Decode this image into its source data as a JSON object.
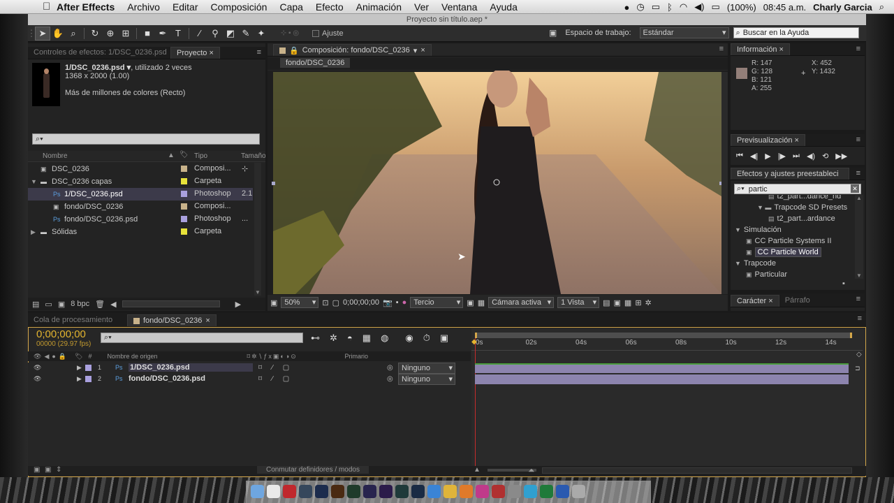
{
  "menubar": {
    "apple": "",
    "app": "After Effects",
    "items": [
      "Archivo",
      "Editar",
      "Composición",
      "Capa",
      "Efecto",
      "Animación",
      "Ver",
      "Ventana",
      "Ayuda"
    ],
    "battery": "(100%)",
    "time": "08:45 a.m.",
    "user": "Charly Garcia"
  },
  "window": {
    "title": "Proyecto sin título.aep *"
  },
  "toolbar": {
    "snap_label": "Ajuste",
    "workspace_label": "Espacio de trabajo:",
    "workspace_value": "Estándar",
    "help_placeholder": "Buscar en la Ayuda"
  },
  "project": {
    "tab_effects": "Controles de efectos: 1/DSC_0236.psd",
    "tab_project": "Proyecto",
    "item_name": "1/DSC_0236.psd ▾",
    "item_used": ", utilizado 2 veces",
    "item_dims": "1368 x 2000 (1.00)",
    "item_colors": "Más de millones de colores (Recto)",
    "search_icon": "⌕▾",
    "col_name": "Nombre",
    "col_type": "Tipo",
    "col_size": "Tamaño",
    "items": [
      {
        "name": "DSC_0236",
        "type": "Composi...",
        "extra": "",
        "indent": 0,
        "color": "#c8b28a",
        "kind": "comp"
      },
      {
        "name": "DSC_0236 capas",
        "type": "Carpeta",
        "extra": "",
        "indent": 0,
        "color": "#e8e23a",
        "kind": "folder"
      },
      {
        "name": "1/DSC_0236.psd",
        "type": "Photoshop",
        "extra": "2.1",
        "indent": 1,
        "color": "#a9a0de",
        "kind": "psd"
      },
      {
        "name": "fondo/DSC_0236",
        "type": "Composi...",
        "extra": "",
        "indent": 1,
        "color": "#c8b28a",
        "kind": "comp"
      },
      {
        "name": "fondo/DSC_0236.psd",
        "type": "Photoshop",
        "extra": "...",
        "indent": 1,
        "color": "#a9a0de",
        "kind": "psd"
      },
      {
        "name": "Sólidas",
        "type": "Carpeta",
        "extra": "",
        "indent": 0,
        "color": "#e8e23a",
        "kind": "folder"
      }
    ],
    "bpc": "8 bpc"
  },
  "comp": {
    "tab": "Composición: fondo/DSC_0236",
    "flow": "fondo/DSC_0236",
    "zoom": "50%",
    "timecode": "0;00;00;00",
    "grid": "Tercio",
    "camera": "Cámara activa",
    "views": "1 Vista"
  },
  "info": {
    "tab": "Información",
    "r": "R:  147",
    "g": "G:  128",
    "b": "B:  121",
    "a": "A:  255",
    "x": "X:  452",
    "y": "Y:  1432",
    "swatch": "#937f79"
  },
  "preview": {
    "tab": "Previsualización"
  },
  "effects": {
    "tab": "Efectos y ajustes preestableci",
    "search": "partic",
    "items": [
      {
        "label": "t2_part...dance_nd",
        "indent": 3,
        "kind": "preset"
      },
      {
        "label": "Trapcode SD Presets",
        "indent": 2,
        "kind": "folder"
      },
      {
        "label": "t2_part...ardance",
        "indent": 3,
        "kind": "preset"
      },
      {
        "label": "Simulación",
        "indent": 0,
        "kind": "category"
      },
      {
        "label": "CC Particle Systems II",
        "indent": 1,
        "kind": "effect"
      },
      {
        "label": "CC Particle World",
        "indent": 1,
        "kind": "effect",
        "selected": true
      },
      {
        "label": "Trapcode",
        "indent": 0,
        "kind": "category"
      },
      {
        "label": "Particular",
        "indent": 1,
        "kind": "effect"
      }
    ]
  },
  "character": {
    "tab_char": "Carácter",
    "tab_para": "Párrafo"
  },
  "timeline": {
    "tab_render": "Cola de procesamiento",
    "tab_comp": "fondo/DSC_0236",
    "timecode": "0;00;00;00",
    "fps": "00000 (29.97 fps)",
    "col_num": "#",
    "col_source": "Nombre de origen",
    "col_parent": "Primario",
    "ruler": [
      "0s",
      "02s",
      "04s",
      "06s",
      "08s",
      "10s",
      "12s",
      "14s"
    ],
    "layers": [
      {
        "num": "1",
        "name": "1/DSC_0236.psd",
        "parent": "Ninguno"
      },
      {
        "num": "2",
        "name": "fondo/DSC_0236.psd",
        "parent": "Ninguno"
      }
    ],
    "toggle_label": "Conmutar definidores / modos"
  },
  "dock": {
    "icons": [
      "finder",
      "calendar",
      "acrobat",
      "lightroom",
      "photoshop",
      "illustrator",
      "audition",
      "after-effects",
      "premiere",
      "speedgrade",
      "encoder",
      "safari",
      "chrome",
      "firefox",
      "itunes",
      "photo-booth",
      "preview",
      "vectorize",
      "excel",
      "word",
      "trash"
    ]
  }
}
